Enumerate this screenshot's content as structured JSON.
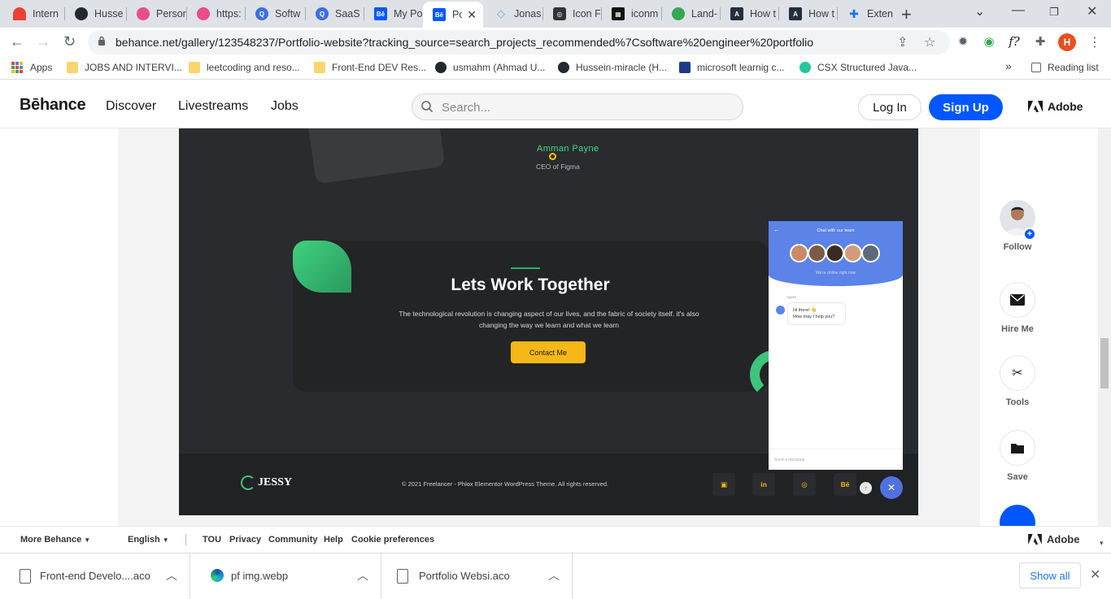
{
  "browser": {
    "tabs": [
      {
        "label": "Intern",
        "icon": "arc-icon",
        "color": "#e94235"
      },
      {
        "label": "Husse",
        "icon": "github-icon",
        "color": "#24292e"
      },
      {
        "label": "Persor",
        "icon": "dribbble-icon",
        "color": "#ea4c89"
      },
      {
        "label": "https:",
        "icon": "dribbble-icon",
        "color": "#ea4c89"
      },
      {
        "label": "Softw",
        "icon": "search-site-icon",
        "color": "#3b6fe0"
      },
      {
        "label": "SaaS I",
        "icon": "search-site-icon",
        "color": "#3b6fe0"
      },
      {
        "label": "My Po",
        "icon": "behance-icon",
        "color": "#0057ff"
      },
      {
        "label": "Po",
        "icon": "behance-icon",
        "color": "#0057ff",
        "active": true
      },
      {
        "label": "Jonas",
        "icon": "diamond-icon",
        "color": "#6fa8dc"
      },
      {
        "label": "Icon F",
        "icon": "iconfinder-icon",
        "color": "#333333"
      },
      {
        "label": "iconm",
        "icon": "iconmonstr-icon",
        "color": "#111111"
      },
      {
        "label": "Land-",
        "icon": "globe-icon",
        "color": "#34a853"
      },
      {
        "label": "How t",
        "icon": "aw-icon",
        "color": "#232f3e"
      },
      {
        "label": "How t",
        "icon": "aw-icon",
        "color": "#232f3e"
      },
      {
        "label": "Exten",
        "icon": "puzzle-icon",
        "color": "#1a73e8"
      }
    ],
    "url": "behance.net/gallery/123548237/Portfolio-website?tracking_source=search_projects_recommended%7Csoftware%20engineer%20portfolio",
    "profile_initial": "H",
    "extension_f": "f?",
    "bookmarks": [
      {
        "label": "Apps",
        "icon": "apps-grid-icon"
      },
      {
        "label": "JOBS AND INTERVI...",
        "icon": "folder-icon"
      },
      {
        "label": "leetcoding and reso...",
        "icon": "folder-icon"
      },
      {
        "label": "Front-End DEV Res...",
        "icon": "folder-icon"
      },
      {
        "label": "usmahm (Ahmad U...",
        "icon": "github-icon"
      },
      {
        "label": "Hussein-miracle (H...",
        "icon": "github-icon"
      },
      {
        "label": "microsoft learnig c...",
        "icon": "video-icon"
      },
      {
        "label": "CSX Structured Java...",
        "icon": "csx-icon"
      }
    ],
    "more_bookmarks": "»",
    "reading_list": "Reading list"
  },
  "behance": {
    "logo": "Bēhance",
    "nav": [
      "Discover",
      "Livestreams",
      "Jobs"
    ],
    "search_placeholder": "Search...",
    "login": "Log In",
    "signup": "Sign Up",
    "adobe": "Adobe"
  },
  "project": {
    "testimonial_name": "Amman Payne",
    "testimonial_role": "CEO of Figma",
    "cta_title": "Lets Work Together",
    "cta_desc": "The technological revolution is changing aspect of our lives, and the fabric of society itself. it's also changing the way we learn and what we learn",
    "cta_button": "Contact Me",
    "footer_logo": "JESSY",
    "footer_copy": "© 2021 Freelancer - Phlox Elementor WordPress Theme. All rights reserved.",
    "social": [
      "twitch",
      "in",
      "ig",
      "Bē"
    ],
    "chat": {
      "title": "Chat with our team",
      "online": "We're online right now",
      "agent": "Agent",
      "greeting_1": "Hi there! 👋",
      "greeting_2": "How may I help you?",
      "input_placeholder": "Send a message"
    }
  },
  "sidebar": {
    "follow": "Follow",
    "hire": "Hire Me",
    "tools": "Tools",
    "save": "Save"
  },
  "footer": {
    "more_behance": "More Behance",
    "language": "English",
    "links": [
      "TOU",
      "Privacy",
      "Community",
      "Help",
      "Cookie preferences"
    ],
    "adobe": "Adobe"
  },
  "downloads": {
    "items": [
      {
        "name": "Front-end Develo....aco",
        "icon": "file-icon"
      },
      {
        "name": "pf img.webp",
        "icon": "edge-icon"
      },
      {
        "name": "Portfolio Websi.aco",
        "icon": "file-icon"
      }
    ],
    "show_all": "Show all"
  }
}
